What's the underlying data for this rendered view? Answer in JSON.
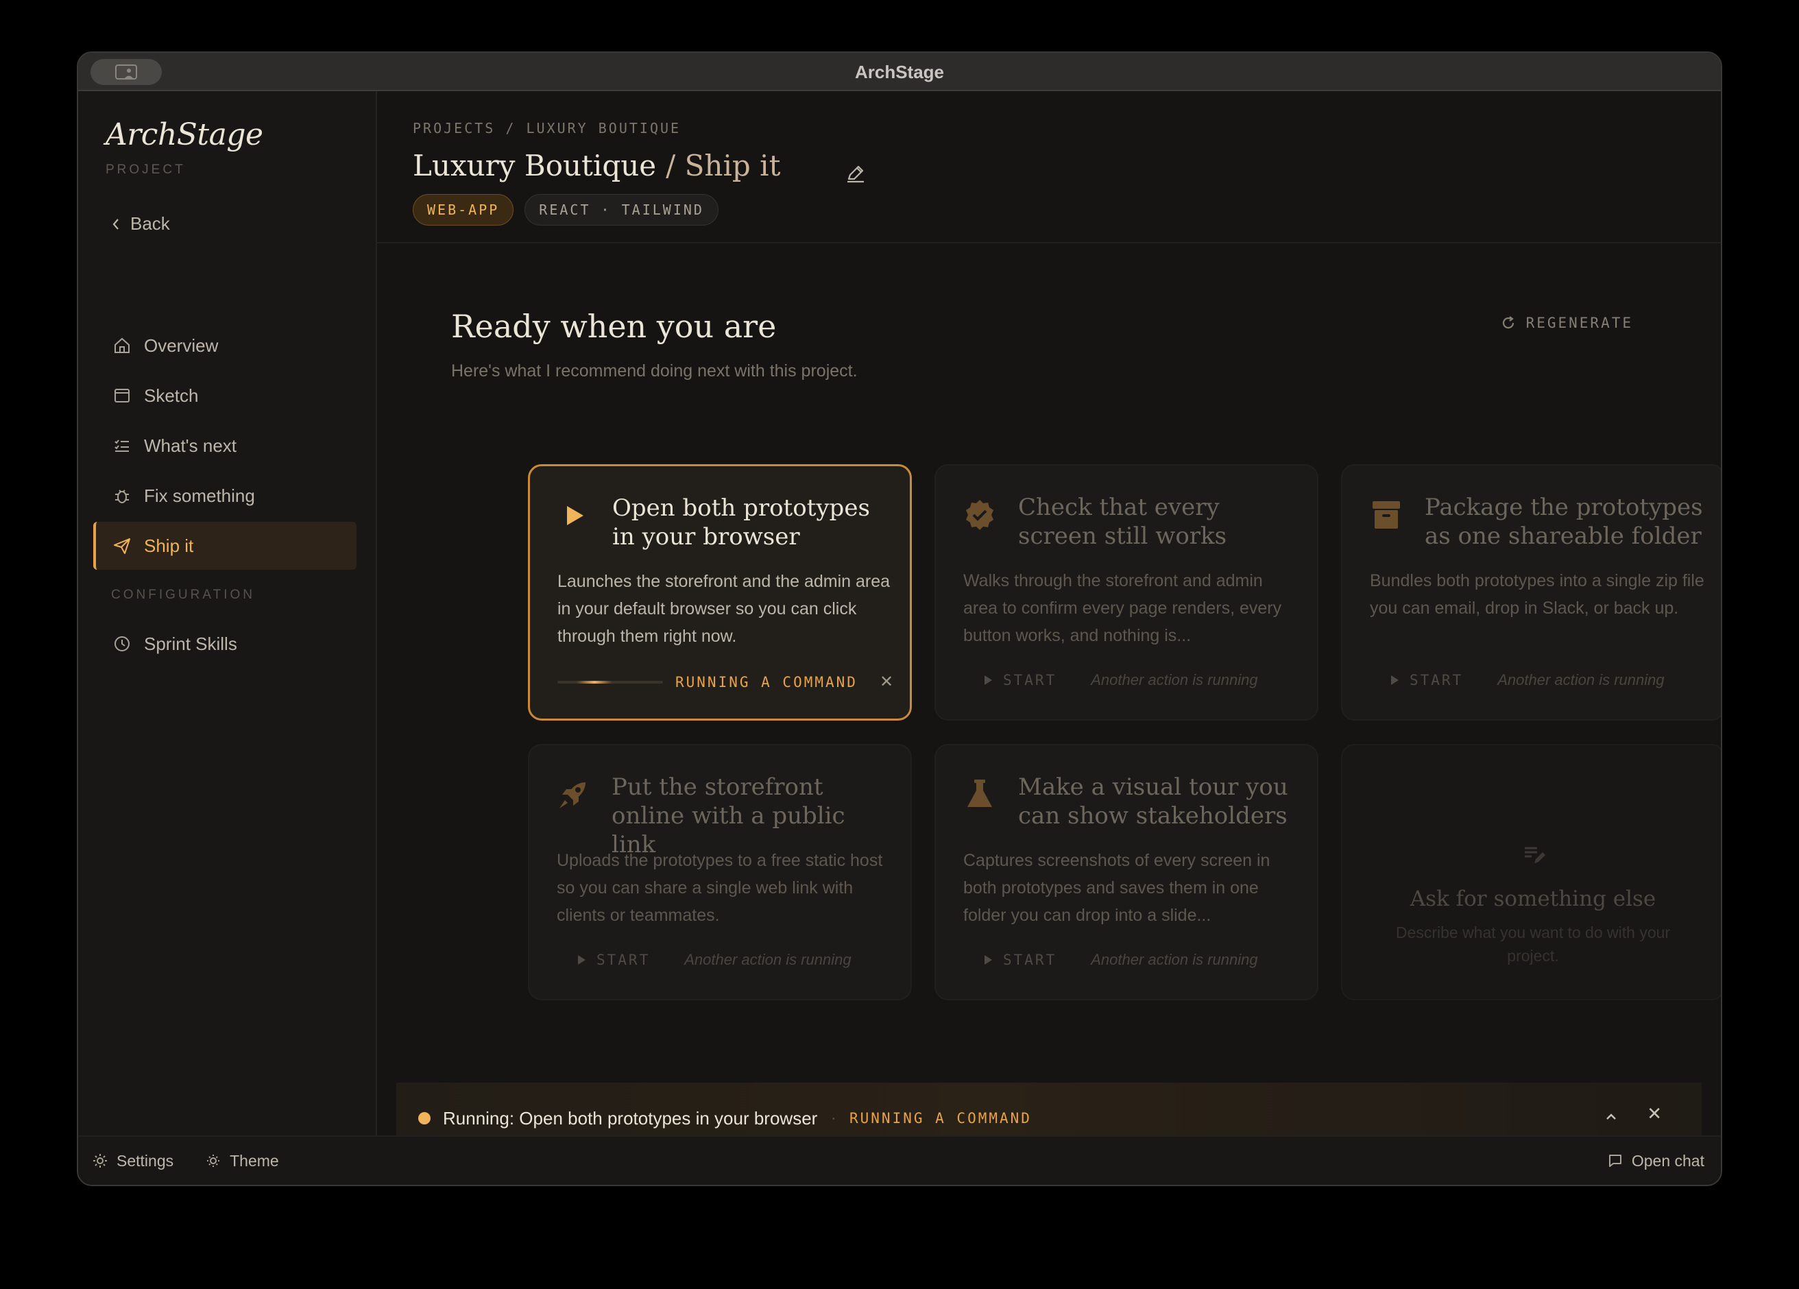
{
  "window": {
    "title": "ArchStage"
  },
  "sidebar": {
    "brand": "ArchStage",
    "brand_sub": "PROJECT",
    "back_label": "Back",
    "items": [
      {
        "label": "Overview",
        "icon": "home-icon"
      },
      {
        "label": "Sketch",
        "icon": "browser-icon"
      },
      {
        "label": "What's next",
        "icon": "checklist-icon"
      },
      {
        "label": "Fix something",
        "icon": "bug-icon"
      },
      {
        "label": "Ship it",
        "icon": "send-icon",
        "active": true
      }
    ],
    "section_label": "CONFIGURATION",
    "config_items": [
      {
        "label": "Sprint Skills",
        "icon": "clock-icon"
      }
    ]
  },
  "header": {
    "breadcrumb": "PROJECTS / LUXURY BOUTIQUE",
    "title": "Luxury Boutique",
    "title_sub": "/ Ship it",
    "tags": [
      "WEB-APP",
      "REACT · TAILWIND"
    ]
  },
  "main": {
    "heading": "Ready when you are",
    "subheading": "Here's what I recommend doing next with this project.",
    "regenerate_label": "REGENERATE",
    "cards": [
      {
        "title": "Open both prototypes in your browser",
        "desc": "Launches the storefront and the admin area in your default browser so you can click through them right now.",
        "status": "RUNNING A COMMAND",
        "icon": "play-icon"
      },
      {
        "title": "Check that every screen still works",
        "desc": "Walks through the storefront and admin area to confirm every page renders, every button works, and nothing is...",
        "start_label": "START",
        "busy_label": "Another action is running",
        "icon": "verified-badge-icon"
      },
      {
        "title": "Package the prototypes as one shareable folder",
        "desc": "Bundles both prototypes into a single zip file you can email, drop in Slack, or back up.",
        "start_label": "START",
        "busy_label": "Another action is running",
        "icon": "archive-box-icon"
      },
      {
        "title": "Put the storefront online with a public link",
        "desc": "Uploads the prototypes to a free static host so you can share a single web link with clients or teammates.",
        "start_label": "START",
        "busy_label": "Another action is running",
        "icon": "rocket-icon"
      },
      {
        "title": "Make a visual tour you can show stakeholders",
        "desc": "Captures screenshots of every screen in both prototypes and saves them in one folder you can drop into a slide...",
        "start_label": "START",
        "busy_label": "Another action is running",
        "icon": "flask-icon"
      }
    ],
    "custom": {
      "title": "Ask for something else",
      "desc": "Describe what you want to do with your project."
    }
  },
  "runbar": {
    "text": "Running: Open both prototypes in your browser",
    "separator": "·",
    "status": "RUNNING A COMMAND"
  },
  "footer": {
    "settings_label": "Settings",
    "theme_label": "Theme",
    "chat_label": "Open chat"
  },
  "colors": {
    "accent": "#f0b45a",
    "background": "#151413",
    "active_border": "#c98a3a"
  }
}
